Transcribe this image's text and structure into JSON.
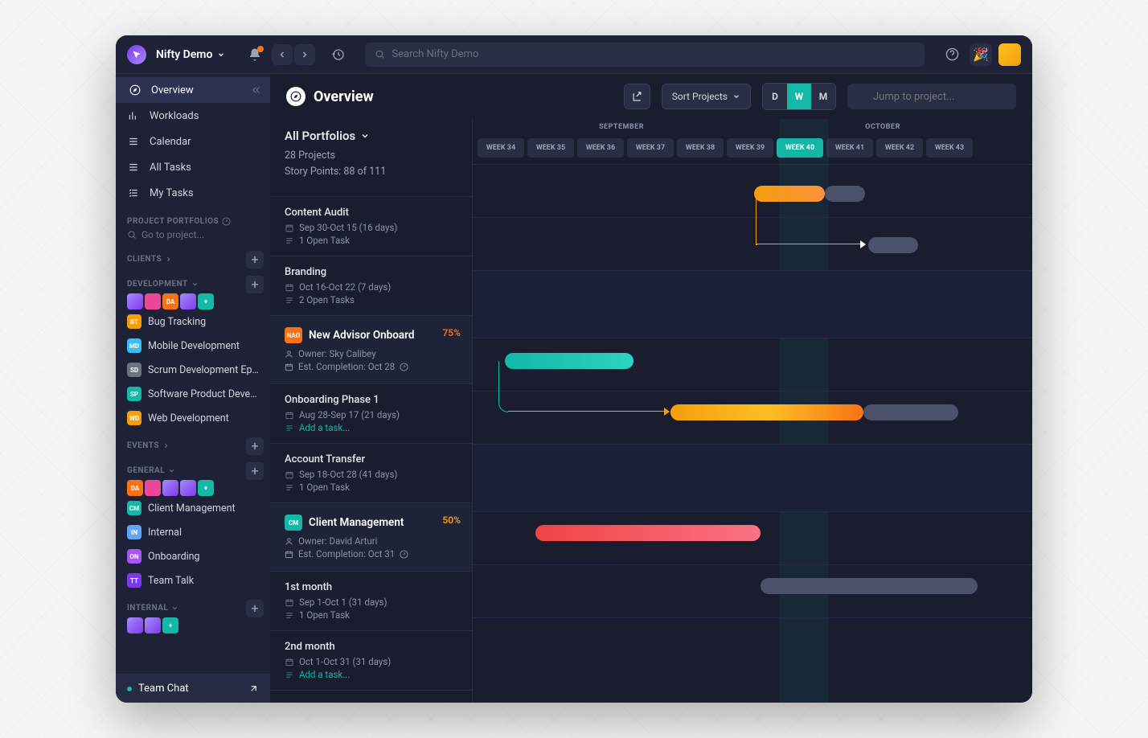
{
  "workspace": {
    "name": "Nifty Demo"
  },
  "search": {
    "placeholder": "Search Nifty Demo"
  },
  "nav": {
    "overview": "Overview",
    "workloads": "Workloads",
    "calendar": "Calendar",
    "all_tasks": "All Tasks",
    "my_tasks": "My Tasks"
  },
  "sections": {
    "portfolios_label": "PROJECT PORTFOLIOS",
    "go_to_project": "Go to project...",
    "clients": "CLIENTS",
    "development": "DEVELOPMENT",
    "events": "EVENTS",
    "general": "GENERAL",
    "internal": "INTERNAL"
  },
  "dev_projects": [
    {
      "k": "bt",
      "label": "Bug Tracking",
      "color": "#f59e0b"
    },
    {
      "k": "md",
      "label": "Mobile Development",
      "color": "#38bdf8"
    },
    {
      "k": "sd",
      "label": "Scrum Development Epic",
      "color": "#6b7280"
    },
    {
      "k": "sp",
      "label": "Software Product Devel...",
      "color": "#14b8a6"
    },
    {
      "k": "wd",
      "label": "Web Development",
      "color": "#f59e0b"
    }
  ],
  "gen_projects": [
    {
      "k": "cm",
      "label": "Client Management",
      "color": "#14b8a6"
    },
    {
      "k": "in",
      "label": "Internal",
      "color": "#60a5fa"
    },
    {
      "k": "on",
      "label": "Onboarding",
      "color": "#a855f7"
    },
    {
      "k": "tt",
      "label": "Team Talk",
      "color": "#7c3aed"
    }
  ],
  "team_chat": "Team Chat",
  "page": {
    "title": "Overview",
    "sort": "Sort Projects",
    "jump": "Jump to project..."
  },
  "view_toggle": {
    "d": "D",
    "w": "W",
    "m": "M"
  },
  "portfolio": {
    "title": "All Portfolios",
    "subtitle": "28 Projects",
    "story_points": "Story Points: 88 of 111"
  },
  "months": {
    "sep": "SEPTEMBER",
    "oct": "OCTOBER"
  },
  "weeks": [
    "WEEK 34",
    "WEEK 35",
    "WEEK 36",
    "WEEK 37",
    "WEEK 38",
    "WEEK 39",
    "WEEK 40",
    "WEEK 41",
    "WEEK 42",
    "WEEK 43"
  ],
  "active_week": 6,
  "rows": [
    {
      "type": "task",
      "title": "Content Audit",
      "date": "Sep 30-Oct 15 (16 days)",
      "open": "1 Open Task"
    },
    {
      "type": "task",
      "title": "Branding",
      "date": "Oct 16-Oct 22 (7 days)",
      "open": "2 Open Tasks"
    },
    {
      "type": "proj",
      "badge": "NAO",
      "badge_color": "#f97316",
      "title": "New Advisor Onboard",
      "pct": "75%",
      "pct_color": "#f97316",
      "owner": "Owner: Sky Calibey",
      "est": "Est. Completion: Oct 28"
    },
    {
      "type": "task",
      "title": "Onboarding Phase 1",
      "date": "Aug 28-Sep 17 (21 days)",
      "open": "",
      "add": "Add a task..."
    },
    {
      "type": "task",
      "title": "Account Transfer",
      "date": "Sep 18-Oct 28 (41 days)",
      "open": "1 Open Task"
    },
    {
      "type": "proj",
      "badge": "CM",
      "badge_color": "#14b8a6",
      "title": "Client Management",
      "pct": "50%",
      "pct_color": "#f59e0b",
      "owner": "Owner: David Arturi",
      "est": "Est. Completion: Oct 31"
    },
    {
      "type": "task",
      "title": "1st month",
      "date": "Sep 1-Oct 1 (31 days)",
      "open": "1 Open Task"
    },
    {
      "type": "task",
      "title": "2nd month",
      "date": "Oct 1-Oct 31 (31 days)",
      "open": "",
      "add": "Add a task..."
    }
  ]
}
